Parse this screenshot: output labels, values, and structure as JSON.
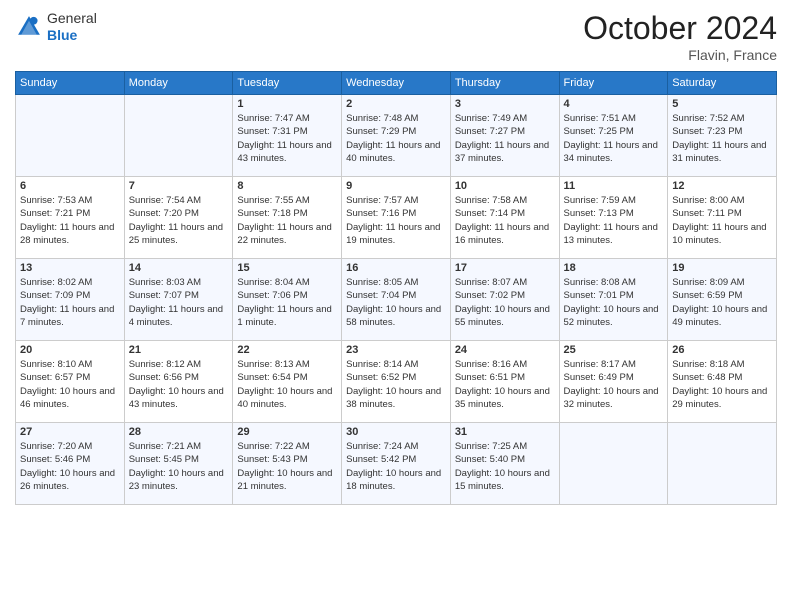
{
  "header": {
    "logo_general": "General",
    "logo_blue": "Blue",
    "month_title": "October 2024",
    "location": "Flavin, France"
  },
  "weekdays": [
    "Sunday",
    "Monday",
    "Tuesday",
    "Wednesday",
    "Thursday",
    "Friday",
    "Saturday"
  ],
  "weeks": [
    [
      {
        "day": "",
        "info": ""
      },
      {
        "day": "",
        "info": ""
      },
      {
        "day": "1",
        "info": "Sunrise: 7:47 AM\nSunset: 7:31 PM\nDaylight: 11 hours and 43 minutes."
      },
      {
        "day": "2",
        "info": "Sunrise: 7:48 AM\nSunset: 7:29 PM\nDaylight: 11 hours and 40 minutes."
      },
      {
        "day": "3",
        "info": "Sunrise: 7:49 AM\nSunset: 7:27 PM\nDaylight: 11 hours and 37 minutes."
      },
      {
        "day": "4",
        "info": "Sunrise: 7:51 AM\nSunset: 7:25 PM\nDaylight: 11 hours and 34 minutes."
      },
      {
        "day": "5",
        "info": "Sunrise: 7:52 AM\nSunset: 7:23 PM\nDaylight: 11 hours and 31 minutes."
      }
    ],
    [
      {
        "day": "6",
        "info": "Sunrise: 7:53 AM\nSunset: 7:21 PM\nDaylight: 11 hours and 28 minutes."
      },
      {
        "day": "7",
        "info": "Sunrise: 7:54 AM\nSunset: 7:20 PM\nDaylight: 11 hours and 25 minutes."
      },
      {
        "day": "8",
        "info": "Sunrise: 7:55 AM\nSunset: 7:18 PM\nDaylight: 11 hours and 22 minutes."
      },
      {
        "day": "9",
        "info": "Sunrise: 7:57 AM\nSunset: 7:16 PM\nDaylight: 11 hours and 19 minutes."
      },
      {
        "day": "10",
        "info": "Sunrise: 7:58 AM\nSunset: 7:14 PM\nDaylight: 11 hours and 16 minutes."
      },
      {
        "day": "11",
        "info": "Sunrise: 7:59 AM\nSunset: 7:13 PM\nDaylight: 11 hours and 13 minutes."
      },
      {
        "day": "12",
        "info": "Sunrise: 8:00 AM\nSunset: 7:11 PM\nDaylight: 11 hours and 10 minutes."
      }
    ],
    [
      {
        "day": "13",
        "info": "Sunrise: 8:02 AM\nSunset: 7:09 PM\nDaylight: 11 hours and 7 minutes."
      },
      {
        "day": "14",
        "info": "Sunrise: 8:03 AM\nSunset: 7:07 PM\nDaylight: 11 hours and 4 minutes."
      },
      {
        "day": "15",
        "info": "Sunrise: 8:04 AM\nSunset: 7:06 PM\nDaylight: 11 hours and 1 minute."
      },
      {
        "day": "16",
        "info": "Sunrise: 8:05 AM\nSunset: 7:04 PM\nDaylight: 10 hours and 58 minutes."
      },
      {
        "day": "17",
        "info": "Sunrise: 8:07 AM\nSunset: 7:02 PM\nDaylight: 10 hours and 55 minutes."
      },
      {
        "day": "18",
        "info": "Sunrise: 8:08 AM\nSunset: 7:01 PM\nDaylight: 10 hours and 52 minutes."
      },
      {
        "day": "19",
        "info": "Sunrise: 8:09 AM\nSunset: 6:59 PM\nDaylight: 10 hours and 49 minutes."
      }
    ],
    [
      {
        "day": "20",
        "info": "Sunrise: 8:10 AM\nSunset: 6:57 PM\nDaylight: 10 hours and 46 minutes."
      },
      {
        "day": "21",
        "info": "Sunrise: 8:12 AM\nSunset: 6:56 PM\nDaylight: 10 hours and 43 minutes."
      },
      {
        "day": "22",
        "info": "Sunrise: 8:13 AM\nSunset: 6:54 PM\nDaylight: 10 hours and 40 minutes."
      },
      {
        "day": "23",
        "info": "Sunrise: 8:14 AM\nSunset: 6:52 PM\nDaylight: 10 hours and 38 minutes."
      },
      {
        "day": "24",
        "info": "Sunrise: 8:16 AM\nSunset: 6:51 PM\nDaylight: 10 hours and 35 minutes."
      },
      {
        "day": "25",
        "info": "Sunrise: 8:17 AM\nSunset: 6:49 PM\nDaylight: 10 hours and 32 minutes."
      },
      {
        "day": "26",
        "info": "Sunrise: 8:18 AM\nSunset: 6:48 PM\nDaylight: 10 hours and 29 minutes."
      }
    ],
    [
      {
        "day": "27",
        "info": "Sunrise: 7:20 AM\nSunset: 5:46 PM\nDaylight: 10 hours and 26 minutes."
      },
      {
        "day": "28",
        "info": "Sunrise: 7:21 AM\nSunset: 5:45 PM\nDaylight: 10 hours and 23 minutes."
      },
      {
        "day": "29",
        "info": "Sunrise: 7:22 AM\nSunset: 5:43 PM\nDaylight: 10 hours and 21 minutes."
      },
      {
        "day": "30",
        "info": "Sunrise: 7:24 AM\nSunset: 5:42 PM\nDaylight: 10 hours and 18 minutes."
      },
      {
        "day": "31",
        "info": "Sunrise: 7:25 AM\nSunset: 5:40 PM\nDaylight: 10 hours and 15 minutes."
      },
      {
        "day": "",
        "info": ""
      },
      {
        "day": "",
        "info": ""
      }
    ]
  ]
}
